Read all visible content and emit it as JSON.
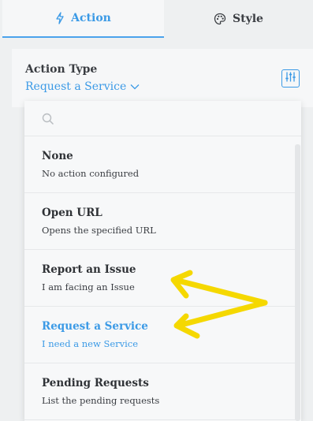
{
  "tabs": {
    "action_label": "Action",
    "style_label": "Style"
  },
  "action_type": {
    "title": "Action Type",
    "value": "Request a Service"
  },
  "dropdown": {
    "search_placeholder": "",
    "items": [
      {
        "title": "None",
        "desc": "No action configured"
      },
      {
        "title": "Open URL",
        "desc": "Opens the specified URL"
      },
      {
        "title": "Report an Issue",
        "desc": "I am facing an Issue"
      },
      {
        "title": "Request a Service",
        "desc": "I need a new Service"
      },
      {
        "title": "Pending Requests",
        "desc": "List the pending requests"
      }
    ],
    "selected_index": 3
  },
  "colors": {
    "accent": "#3b9ae6",
    "annotation": "#f5d800",
    "text": "#2f3236"
  },
  "icons": {
    "action_tab": "lightning-icon",
    "style_tab": "palette-icon",
    "settings": "sliders-icon",
    "search": "search-icon",
    "dropdown_caret": "chevron-down-icon"
  }
}
